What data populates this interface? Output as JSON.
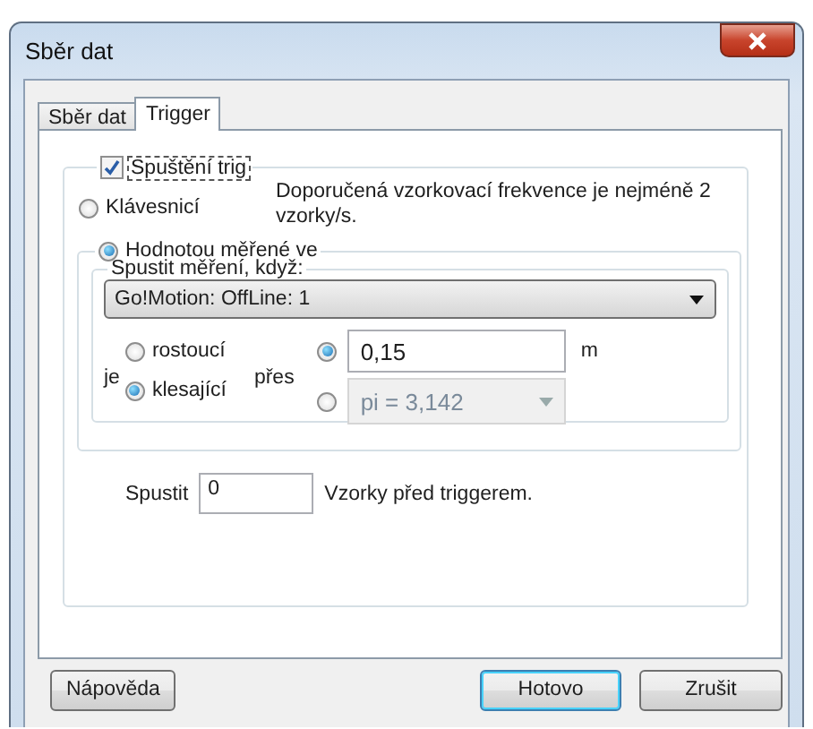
{
  "window": {
    "title": "Sběr dat"
  },
  "tabs": [
    {
      "label": "Sběr dat",
      "selected": false
    },
    {
      "label": "Trigger",
      "selected": true
    }
  ],
  "trigger_checkbox": {
    "label": "Spuštění trig",
    "checked": true
  },
  "trigger_modes": [
    {
      "label": "Klávesnicí",
      "selected": false
    },
    {
      "label": "Hodnotou měřené ve",
      "selected": true
    }
  ],
  "note": "Doporučená vzorkovací frekvence je nejméně 2 vzorky/s.",
  "condition": {
    "legend": "Spustit měření, když:",
    "channel": "Go!Motion: OffLine: 1",
    "direction_label": "je",
    "directions": [
      {
        "label": "rostoucí",
        "selected": false
      },
      {
        "label": "klesající",
        "selected": true
      }
    ],
    "threshold_label": "přes",
    "thresholds": [
      {
        "kind": "input",
        "value": "0,15",
        "unit": "m",
        "selected": true,
        "disabled": false
      },
      {
        "kind": "combo",
        "value": "pi = 3,142",
        "selected": false,
        "disabled": true
      }
    ]
  },
  "pretrigger": {
    "label": "Spustit",
    "value": "0",
    "suffix": "Vzorky před triggerem."
  },
  "buttons": [
    {
      "label": "Nápověda",
      "default": false
    },
    {
      "label": "Hotovo",
      "default": true
    },
    {
      "label": "Zrušit",
      "default": false
    }
  ]
}
